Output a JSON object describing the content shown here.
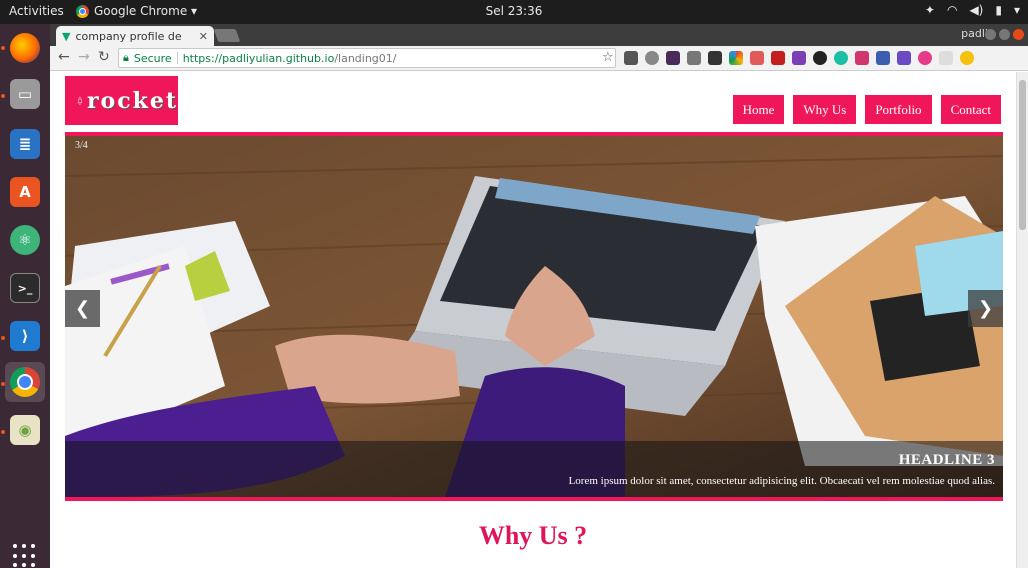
{
  "topbar": {
    "activities": "Activities",
    "app_name": "Google Chrome ▾",
    "clock": "Sel 23:36",
    "tray_icons": [
      "dropbox-icon",
      "wifi-icon",
      "volume-icon",
      "battery-icon",
      "menu-caret-icon"
    ]
  },
  "dock": {
    "items": [
      {
        "name": "firefox",
        "icon": "firefox-icon",
        "color": "#ff6a00"
      },
      {
        "name": "files",
        "icon": "files-icon",
        "color": "#8d8d8d"
      },
      {
        "name": "writer",
        "icon": "writer-icon",
        "color": "#2a72c4"
      },
      {
        "name": "software",
        "icon": "software-center-icon",
        "color": "#e95420"
      },
      {
        "name": "atom",
        "icon": "atom-icon",
        "color": "#3db57a"
      },
      {
        "name": "terminal",
        "icon": "terminal-icon",
        "color": "#2b2b2b"
      },
      {
        "name": "vscode",
        "icon": "vscode-icon",
        "color": "#1e7bd0"
      },
      {
        "name": "chrome",
        "icon": "chrome-icon",
        "color": "#4285f4"
      },
      {
        "name": "image-viewer",
        "icon": "image-viewer-icon",
        "color": "#6fa33f"
      }
    ]
  },
  "browser": {
    "tab_title": "company profile de",
    "user": "padli",
    "secure_label": "Secure",
    "url_host": "https://padliyulian.github.io",
    "url_path": "/landing01/"
  },
  "site": {
    "logo_text": "rocket",
    "nav": [
      "Home",
      "Why Us",
      "Portfolio",
      "Contact"
    ],
    "slider": {
      "counter": "3/4",
      "prev": "❮",
      "next": "❯",
      "headline": "HEADLINE 3",
      "text": "Lorem ipsum dolor sit amet, consectetur adipisicing elit. Obcaecati vel rem molestiae quod alias."
    },
    "section_title": "Why Us ?"
  },
  "colors": {
    "brand": "#f0165a",
    "heading": "#e0145a"
  }
}
